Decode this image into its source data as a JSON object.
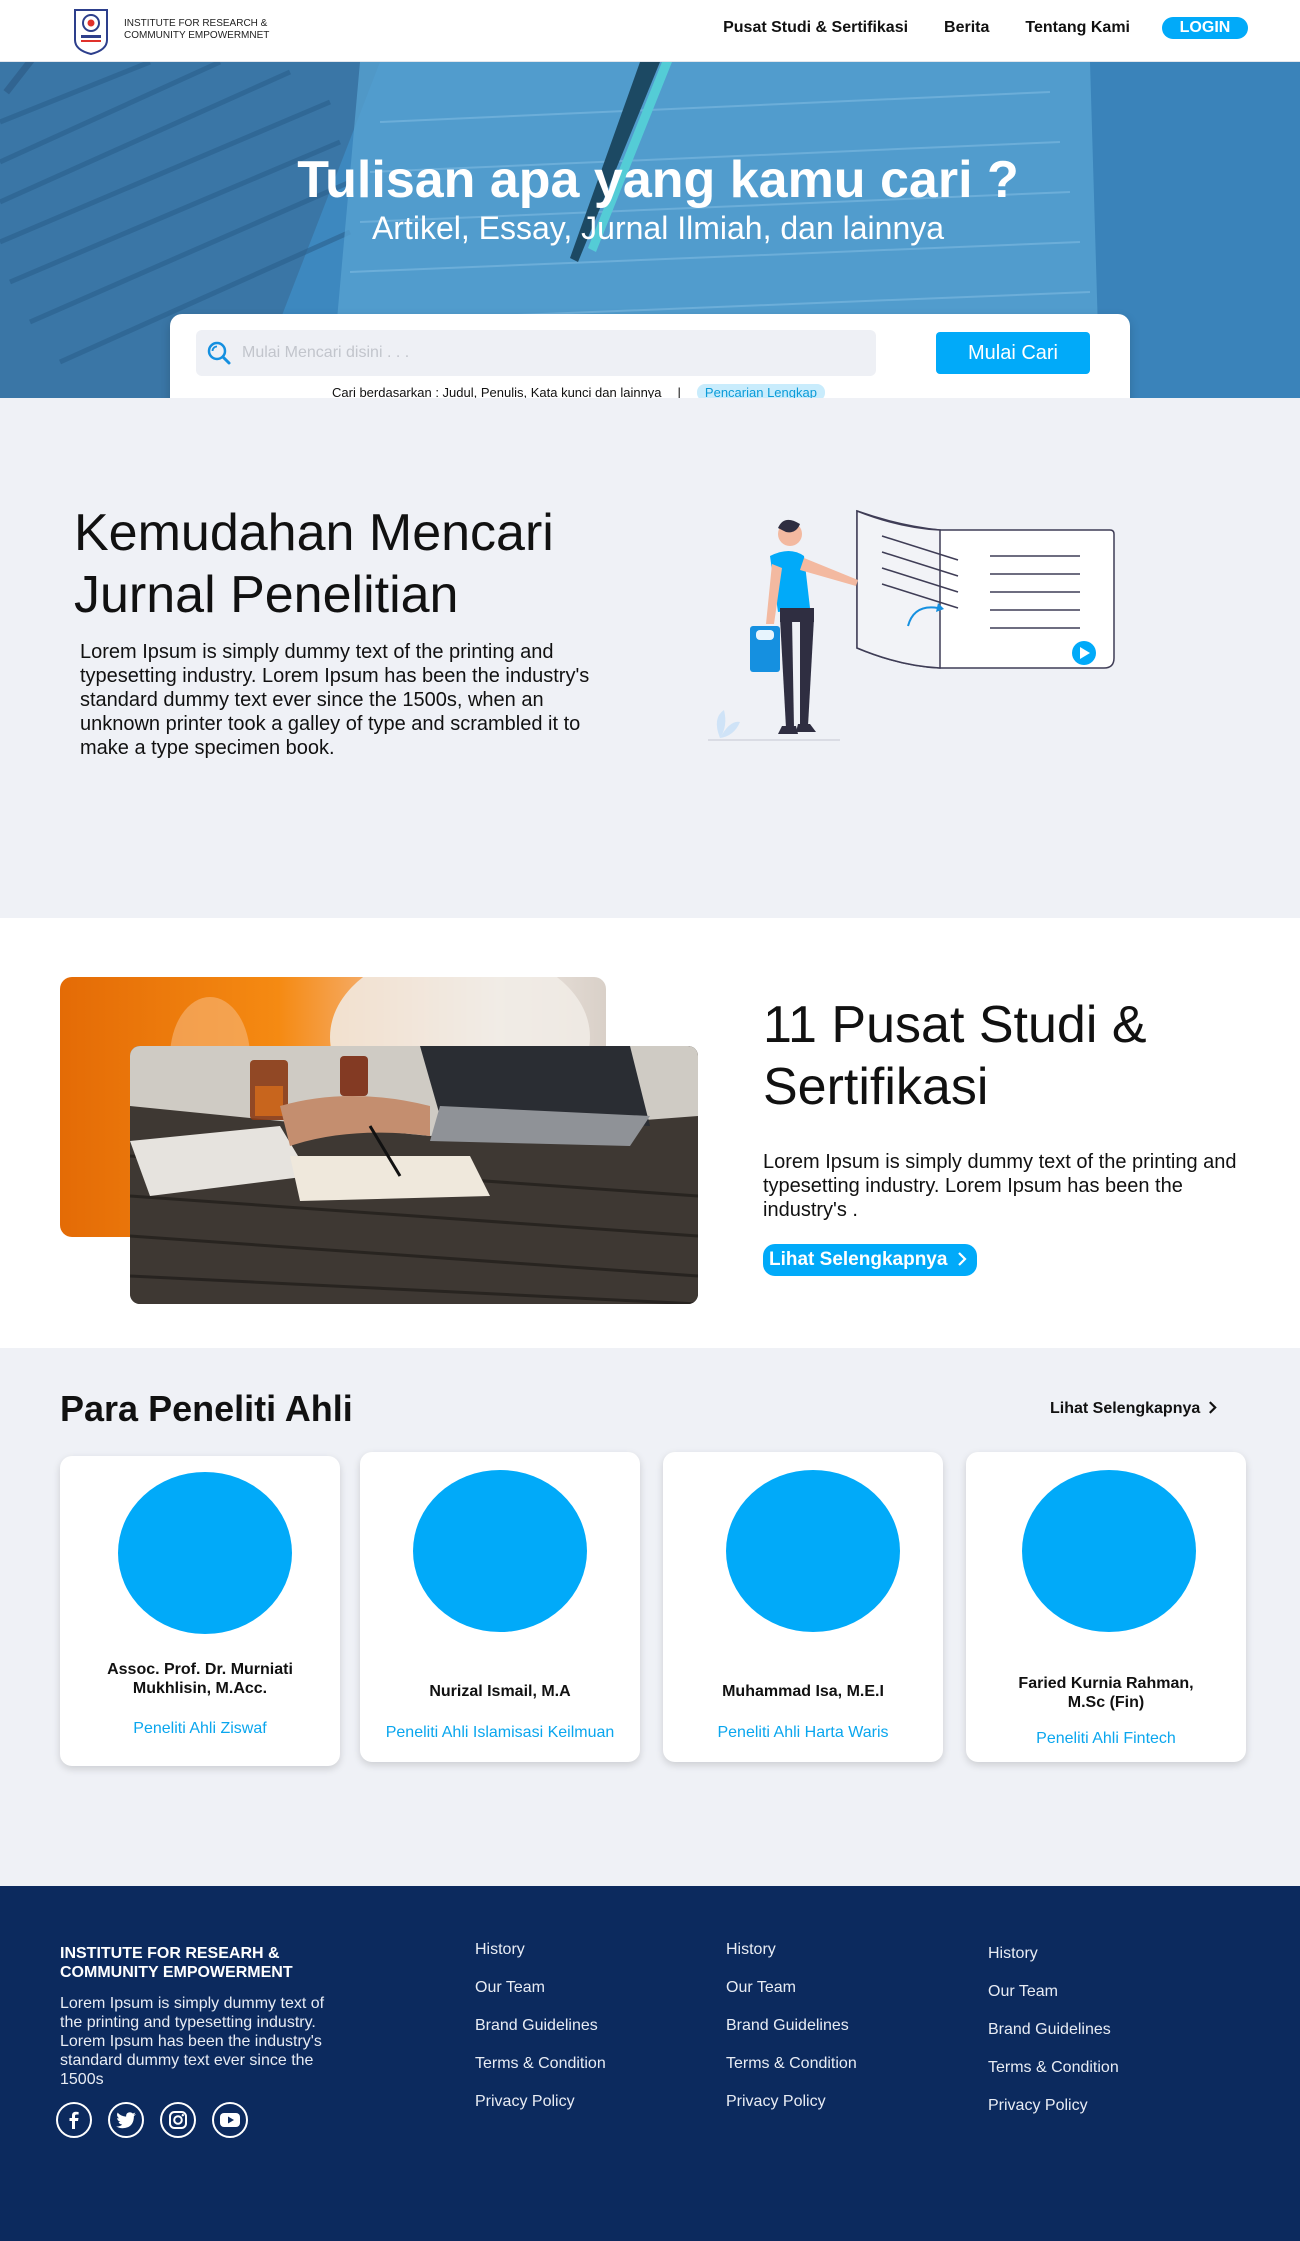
{
  "nav": {
    "brand_line1": "INSTITUTE FOR RESEARCH &",
    "brand_line2": "COMMUNITY EMPOWERMNET",
    "links": [
      "Pusat Studi & Sertifikasi",
      "Berita",
      "Tentang Kami"
    ],
    "login": "LOGIN"
  },
  "hero": {
    "title": "Tulisan apa yang kamu cari ?",
    "subtitle": "Artikel, Essay, Jurnal Ilmiah, dan lainnya"
  },
  "search": {
    "placeholder": "Mulai Mencari disini . . .",
    "button": "Mulai Cari",
    "hint": "Cari berdasarkan :  Judul,  Penulis,  Kata kunci dan lainnya",
    "separator": "|",
    "advanced": "Pencarian Lengkap"
  },
  "feature": {
    "title": "Kemudahan Mencari Jurnal Penelitian",
    "text": "Lorem Ipsum is simply dummy text of the printing and typesetting industry. Lorem Ipsum has been the industry's standard dummy text ever since the 1500s, when an unknown printer took a galley of type and scrambled it to make a type specimen book."
  },
  "studies": {
    "title": "11 Pusat Studi & Sertifikasi",
    "text": "Lorem Ipsum is simply dummy text of the printing and typesetting industry. Lorem Ipsum has been the industry's .",
    "more": "Lihat Selengkapnya"
  },
  "researchers": {
    "title": "Para Peneliti Ahli",
    "see_all": "Lihat Selengkapnya",
    "items": [
      {
        "name": "Assoc. Prof. Dr. Murniati Mukhlisin, M.Acc.",
        "role": "Peneliti Ahli Ziswaf"
      },
      {
        "name": "Nurizal Ismail, M.A",
        "role": "Peneliti Ahli Islamisasi Keilmuan"
      },
      {
        "name": "Muhammad Isa, M.E.I",
        "role": "Peneliti Ahli Harta Waris"
      },
      {
        "name": "Faried Kurnia Rahman, M.Sc (Fin)",
        "role": "Peneliti Ahli Fintech"
      }
    ]
  },
  "footer": {
    "title": "INSTITUTE FOR RESEARH & COMMUNITY EMPOWERMENT",
    "description": "Lorem Ipsum is simply dummy text of the printing and typesetting industry. Lorem Ipsum has been the industry's standard dummy text ever since the 1500s",
    "columns": [
      [
        "History",
        "Our Team",
        "Brand Guidelines",
        "Terms & Condition",
        "Privacy Policy"
      ],
      [
        "History",
        "Our Team",
        "Brand Guidelines",
        "Terms & Condition",
        "Privacy Policy"
      ],
      [
        "History",
        "Our Team",
        "Brand Guidelines",
        "Terms & Condition",
        "Privacy Policy"
      ]
    ],
    "socials": [
      "facebook-icon",
      "twitter-icon",
      "instagram-icon",
      "youtube-icon"
    ]
  },
  "colors": {
    "accent": "#01aaf9",
    "footer_bg": "#0c2a5e",
    "section_bg": "#eff1f6"
  }
}
